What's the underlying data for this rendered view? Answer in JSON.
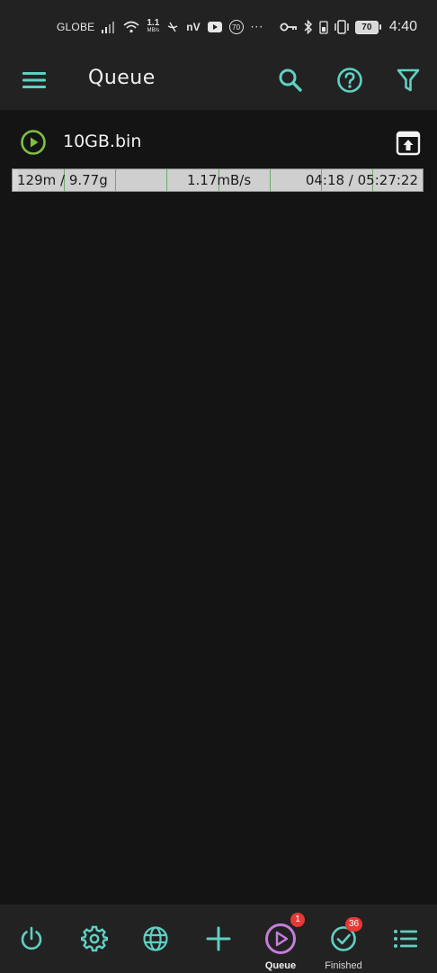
{
  "status_bar": {
    "carrier": "GLOBE",
    "net_speed_value": "1.1",
    "net_speed_unit": "MB/s",
    "nv_label": "nV",
    "circle_value": "70",
    "more": "···",
    "battery_level": "70",
    "time": "4:40"
  },
  "app_bar": {
    "title": "Queue",
    "icons": [
      "menu-icon",
      "search-icon",
      "help-icon",
      "filter-icon"
    ]
  },
  "downloads": [
    {
      "name": "10GB.bin",
      "downloaded": "129m / 9.77g",
      "speed": "1.17mB/s",
      "time": "04:18 / 05:27:22",
      "progress_fraction": 0.013,
      "status_icon": "play-circle-icon",
      "action_icon": "move-to-top-icon"
    }
  ],
  "bottom_nav": {
    "items": [
      {
        "id": "power",
        "icon": "power-icon",
        "label": ""
      },
      {
        "id": "settings",
        "icon": "gear-icon",
        "label": ""
      },
      {
        "id": "browser",
        "icon": "globe-icon",
        "label": ""
      },
      {
        "id": "add",
        "icon": "plus-icon",
        "label": ""
      },
      {
        "id": "queue",
        "icon": "play-circle-icon",
        "label": "Queue",
        "badge": "1",
        "active": true
      },
      {
        "id": "finished",
        "icon": "check-circle-icon",
        "label": "Finished",
        "badge": "36"
      },
      {
        "id": "list",
        "icon": "list-icon",
        "label": ""
      }
    ]
  },
  "colors": {
    "accent": "#5fd0c3",
    "active": "#c77ddb",
    "play_green": "#7cc23f",
    "badge": "#e53935",
    "bar_bg": "#222222",
    "content_bg": "#141414"
  }
}
